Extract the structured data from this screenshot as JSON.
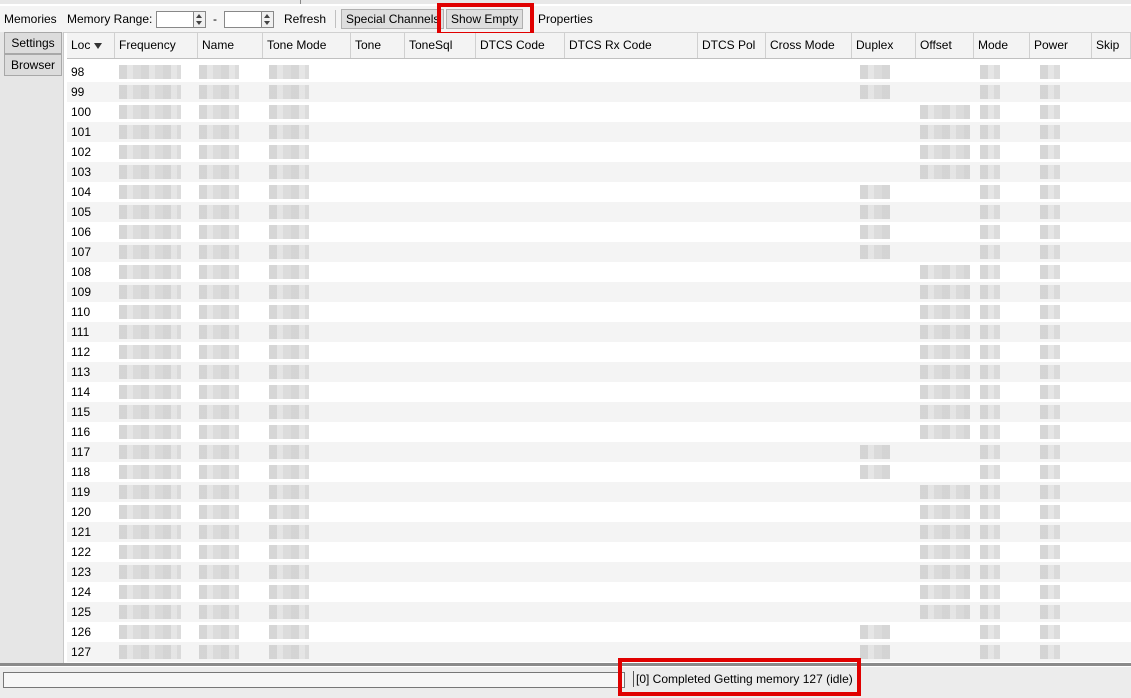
{
  "tabs": {
    "memories": "Memories",
    "settings": "Settings",
    "browser": "Browser"
  },
  "toolbar": {
    "memory_range_label": "Memory Range:",
    "range_start": "",
    "range_dash": "-",
    "range_end": "",
    "refresh": "Refresh",
    "special_channels": "Special Channels",
    "show_empty": "Show Empty",
    "properties": "Properties"
  },
  "columns": [
    "Loc",
    "Frequency",
    "Name",
    "Tone Mode",
    "Tone",
    "ToneSql",
    "DTCS Code",
    "DTCS Rx Code",
    "DTCS Pol",
    "Cross Mode",
    "Duplex",
    "Offset",
    "Mode",
    "Power",
    "Skip"
  ],
  "rows": [
    "98",
    "99",
    "100",
    "101",
    "102",
    "103",
    "104",
    "105",
    "106",
    "107",
    "108",
    "109",
    "110",
    "111",
    "112",
    "113",
    "114",
    "115",
    "116",
    "117",
    "118",
    "119",
    "120",
    "121",
    "122",
    "123",
    "124",
    "125",
    "126",
    "127"
  ],
  "status": {
    "text": "[0] Completed Getting memory 127 (idle)"
  },
  "colors": {
    "highlight": "#e00000"
  }
}
